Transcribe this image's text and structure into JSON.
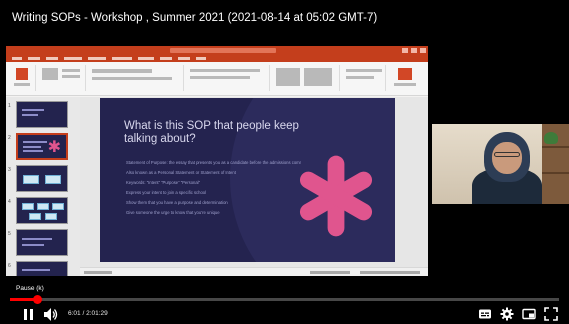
{
  "video": {
    "title": "Writing SOPs - Workshop , Summer 2021 (2021-08-14 at 05:02 GMT-7)",
    "caption": "Pause (k)",
    "current_time": "6:01",
    "separator": " / ",
    "duration": "2:01:29",
    "progress_fraction": 0.05
  },
  "slide": {
    "title": "What is this SOP that people keep talking about?",
    "bullets": [
      "Statement of Purpose: the essay that presents you as a candidate before the admissions committee",
      "Also known as a Personal Statement or Statement of Intent",
      "Keywords: “Intent” “Purpose” “Personal”",
      "Express your intent to join a specific school",
      "Show them that you have a purpose and determination",
      "Give someone the urge to know that you’re unique"
    ]
  },
  "colors": {
    "accent_red": "#ff0000",
    "ppt_brand": "#c43e1c",
    "slide_bg": "#24234f",
    "slide_star": "#e0558e"
  },
  "icons": {
    "pause": "pause-icon",
    "volume": "volume-icon",
    "subtitles": "subtitles-icon",
    "settings": "gear-icon",
    "miniplayer": "miniplayer-icon",
    "fullscreen": "fullscreen-icon"
  }
}
